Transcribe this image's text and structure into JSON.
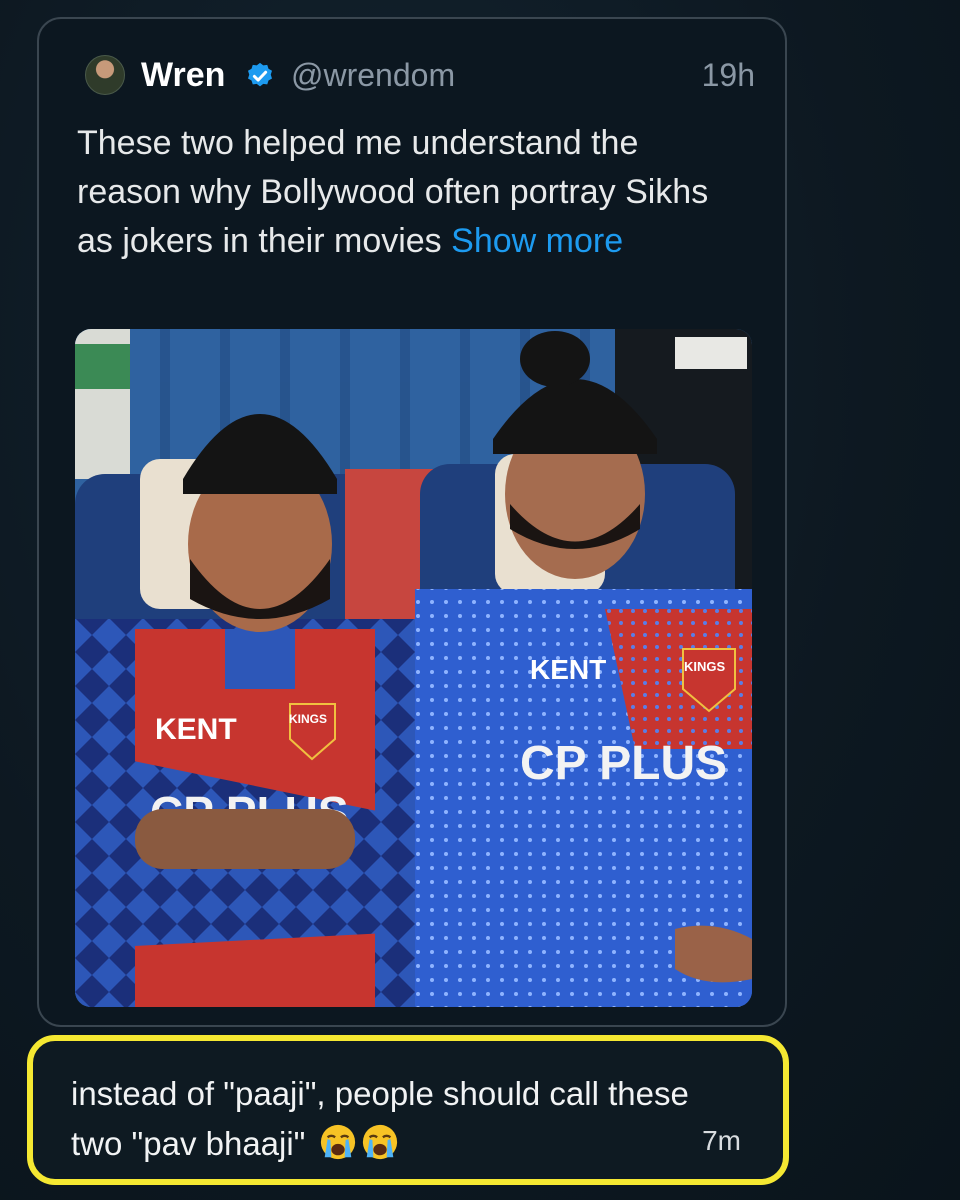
{
  "tweet": {
    "author_name": "Wren",
    "handle": "@wrendom",
    "time": "19h",
    "text": "These two helped me understand the reason why Bollywood often portray Sikhs as jokers in their movies ",
    "show_more": "Show more",
    "photo": {
      "left_jersey_sponsor": "KENT",
      "left_jersey_badge": "KINGS",
      "left_jersey_main": "CP PLUS",
      "right_jersey_sponsor": "KENT",
      "right_jersey_badge": "KINGS",
      "right_jersey_main": "CP PLUS"
    }
  },
  "reply": {
    "text": "instead of \"paaji\", people should call these two \"pav bhaaji\"",
    "emojis": [
      "loudly-crying-face",
      "loudly-crying-face"
    ],
    "time": "7m"
  },
  "colors": {
    "background": "#0f1b24",
    "link": "#1d9bf0",
    "verified": "#1d9bf0",
    "highlight_border": "#f5e832"
  }
}
